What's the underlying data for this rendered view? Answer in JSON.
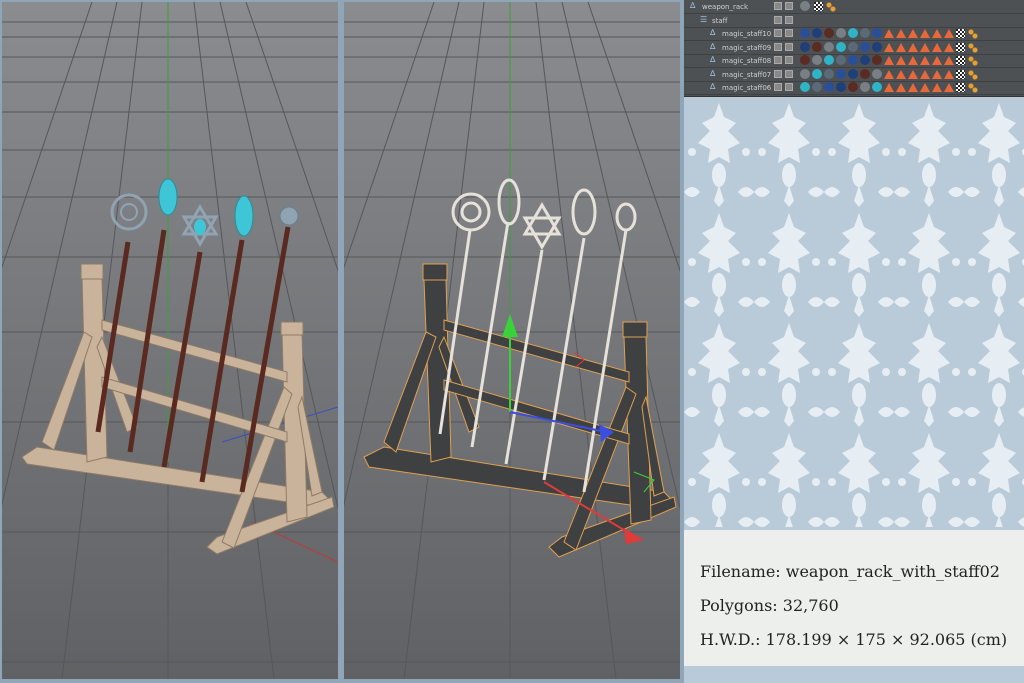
{
  "object_manager": {
    "rows": [
      {
        "name": "weapon_rack",
        "icon": "null-object-icon",
        "indent": 0
      },
      {
        "name": "staff",
        "icon": "group-icon",
        "indent": 1
      },
      {
        "name": "magic_staff10",
        "icon": "null-object-icon",
        "indent": 2
      },
      {
        "name": "magic_staff09",
        "icon": "null-object-icon",
        "indent": 2
      },
      {
        "name": "magic_staff08",
        "icon": "null-object-icon",
        "indent": 2
      },
      {
        "name": "magic_staff07",
        "icon": "null-object-icon",
        "indent": 2
      },
      {
        "name": "magic_staff06",
        "icon": "null-object-icon",
        "indent": 2
      }
    ]
  },
  "info": {
    "filename": "Filename: weapon_rack_with_staff02",
    "polygons": "Polygons: 32,760",
    "dimensions": "H.W.D.: 178.199 × 175 × 92.065 (cm)"
  },
  "colors": {
    "viewport_bg": "#6b6d70",
    "grid": "#5c5e61",
    "wood": "#c9b39b",
    "crystal": "#3fc6d6",
    "metal": "#8fa3b3",
    "selection": "#e0a050",
    "panel_bg": "#b9cbd9",
    "damask": "#e6eef4"
  }
}
